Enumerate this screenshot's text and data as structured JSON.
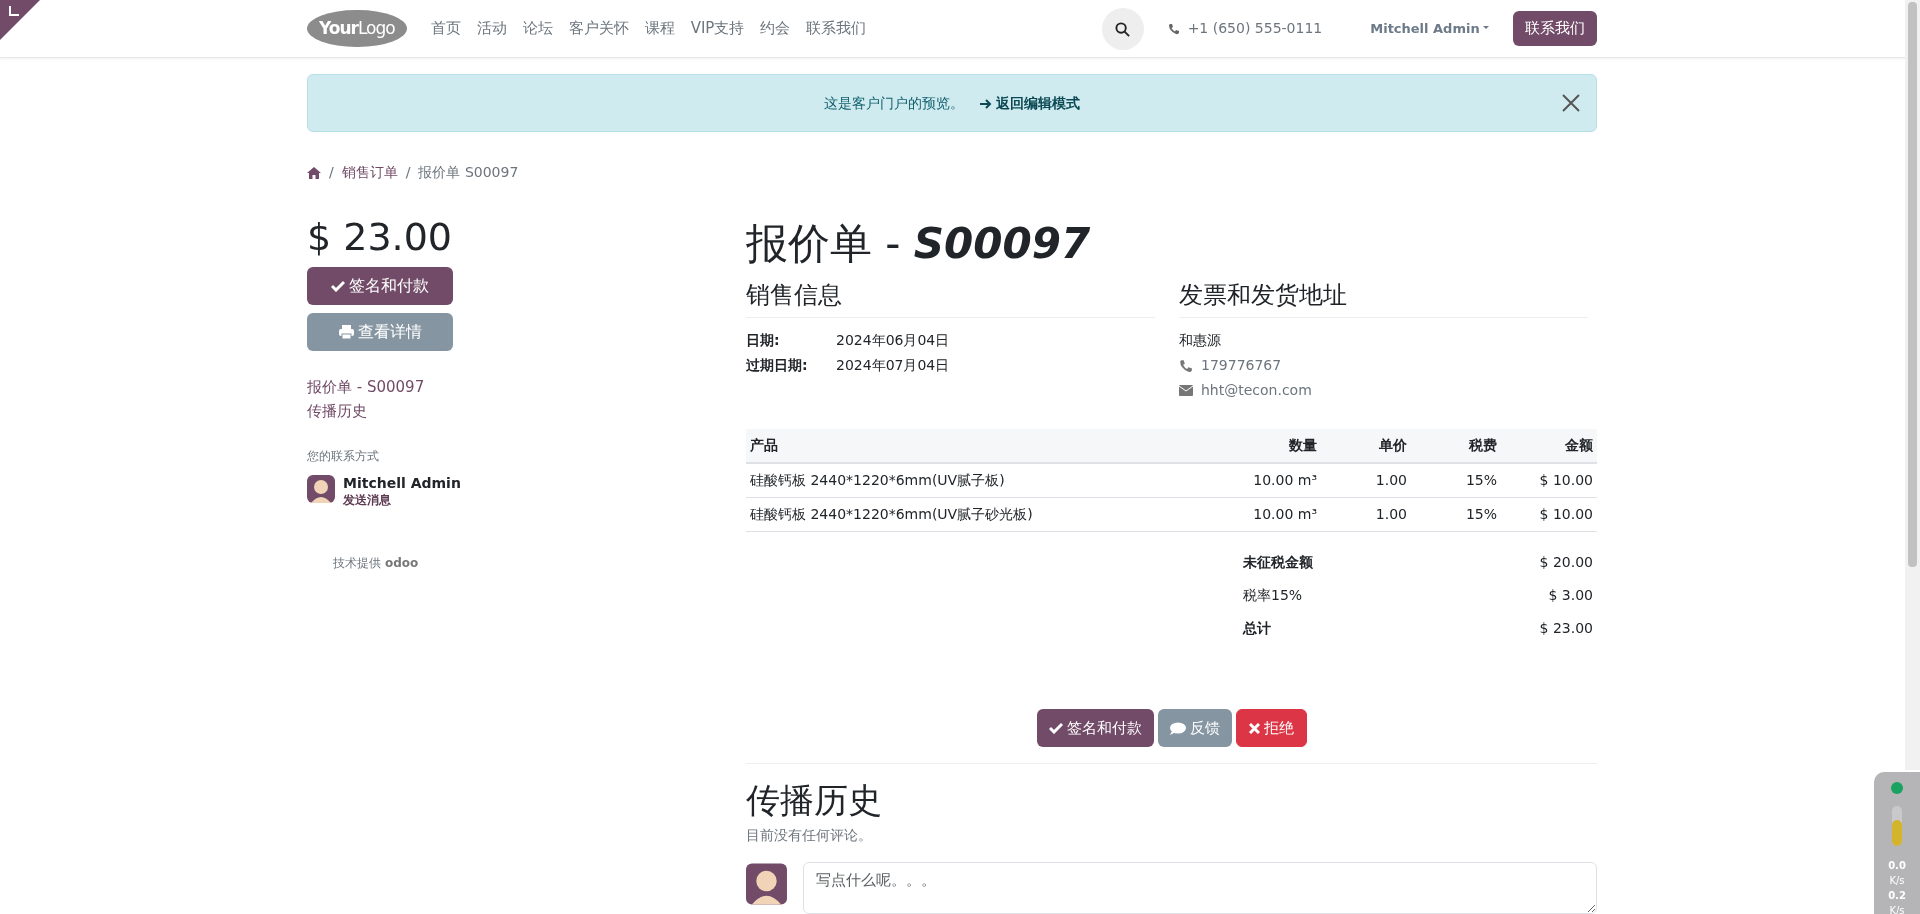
{
  "navbar": {
    "logo": "**Your**Logo",
    "menu": [
      {
        "label": "首页"
      },
      {
        "label": "活动"
      },
      {
        "label": "论坛"
      },
      {
        "label": "客户关怀"
      },
      {
        "label": "课程"
      },
      {
        "label": "VIP支持"
      },
      {
        "label": "约会"
      },
      {
        "label": "联系我们"
      }
    ],
    "phone": "+1 (650) 555-0111",
    "user": "Mitchell Admin",
    "contact_button": "联系我们"
  },
  "alert": {
    "text": "这是客户门户的预览。",
    "link": "返回编辑模式"
  },
  "breadcrumb": [
    {
      "separator": "/",
      "label": "销售订单"
    },
    {
      "separator": "/",
      "label": "报价单 S00097"
    }
  ],
  "sidebar": {
    "amount": "$ 23.00",
    "sign_button": "签名和付款",
    "view_button": "查看详情",
    "links": [
      "报价单 - S00097",
      "传播历史"
    ],
    "contact_label": "您的联系方式",
    "contact_name": "Mitchell Admin",
    "send_message": "发送消息",
    "powered_by": "技术提供",
    "powered_brand": "odoo"
  },
  "document": {
    "title": "报价单 - ",
    "number": "S00097",
    "sales_info": {
      "heading": "销售信息",
      "fields": [
        {
          "label": "日期:",
          "value": "2024年06月04日"
        },
        {
          "label": "过期日期:",
          "value": "2024年07月04日"
        }
      ]
    },
    "address": {
      "heading": "发票和发货地址",
      "name": "和惠源",
      "phone": "179776767",
      "email": "hht@tecon.com"
    },
    "table": {
      "columns": [
        "产品",
        "数量",
        "单价",
        "税费",
        "金额"
      ],
      "rows": [
        [
          "硅酸钙板 2440*1220*6mm(UV腻子板)",
          "10.00 m³",
          "1.00",
          "15%",
          "$ 10.00"
        ],
        [
          "硅酸钙板 2440*1220*6mm(UV腻子砂光板)",
          "10.00 m³",
          "1.00",
          "15%",
          "$ 10.00"
        ]
      ]
    },
    "totals": [
      {
        "label": "未征税金额",
        "value": "$ 20.00",
        "emphasis": true
      },
      {
        "label": "税率15%",
        "value": "$ 3.00",
        "emphasis": false
      },
      {
        "label": "总计",
        "value": "$ 23.00",
        "emphasis": true
      }
    ],
    "actions": [
      {
        "kind": "sign",
        "label": "签名和付款"
      },
      {
        "kind": "feedback",
        "label": "反馈"
      },
      {
        "kind": "reject",
        "label": "拒绝"
      }
    ],
    "history": {
      "heading": "传播历史",
      "empty": "目前没有任何评论。",
      "placeholder": "写点什么呢。。。"
    }
  },
  "monitor": {
    "up": "0.0",
    "up_unit": "K/s",
    "down": "0.2",
    "down_unit": "K/s"
  }
}
